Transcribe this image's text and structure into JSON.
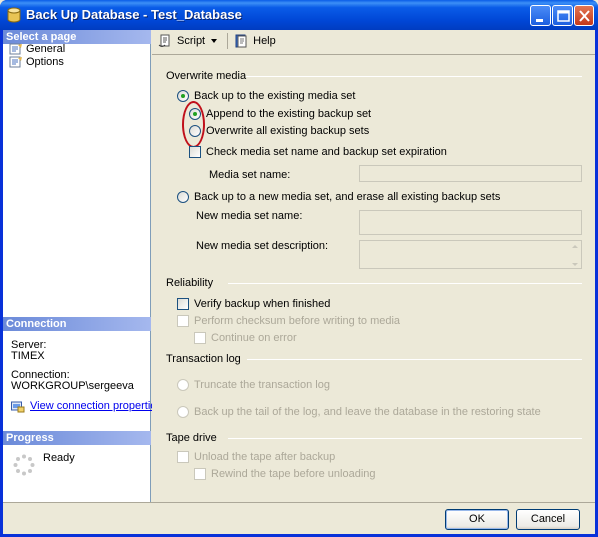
{
  "window": {
    "title": "Back Up Database - Test_Database"
  },
  "left": {
    "select_page_header": "Select a page",
    "pages": [
      {
        "label": "General"
      },
      {
        "label": "Options"
      }
    ],
    "connection_header": "Connection",
    "server_label": "Server:",
    "server_value": "TIMEX",
    "connection_label": "Connection:",
    "connection_value": "WORKGROUP\\sergeeva",
    "view_connection_link": "View connection properties",
    "progress_header": "Progress",
    "progress_status": "Ready"
  },
  "toolbar": {
    "script_label": "Script",
    "help_label": "Help"
  },
  "overwrite": {
    "title": "Overwrite media",
    "backup_existing": "Back up to the existing media set",
    "append": "Append to the existing backup set",
    "overwrite_all": "Overwrite all existing backup sets",
    "check_expiration": "Check media set name and backup set expiration",
    "media_set_name_label": "Media set name:",
    "media_set_name_value": "",
    "backup_new": "Back up to a new media set, and erase all existing backup sets",
    "new_name_label": "New media set name:",
    "new_name_value": "",
    "new_desc_label": "New media set description:",
    "new_desc_value": ""
  },
  "reliability": {
    "title": "Reliability",
    "verify": "Verify backup when finished",
    "checksum": "Perform checksum before writing to media",
    "continue": "Continue on error"
  },
  "transaction_log": {
    "title": "Transaction log",
    "truncate": "Truncate the transaction log",
    "tail": "Back up the tail of the log, and leave the database in the restoring state"
  },
  "tape": {
    "title": "Tape drive",
    "unload": "Unload the tape after backup",
    "rewind": "Rewind the tape before unloading"
  },
  "buttons": {
    "ok": "OK",
    "cancel": "Cancel"
  },
  "colors": {
    "titlebar": "#0a5ce8",
    "pane_header": "#7a96df",
    "highlight": "#c0101a"
  }
}
